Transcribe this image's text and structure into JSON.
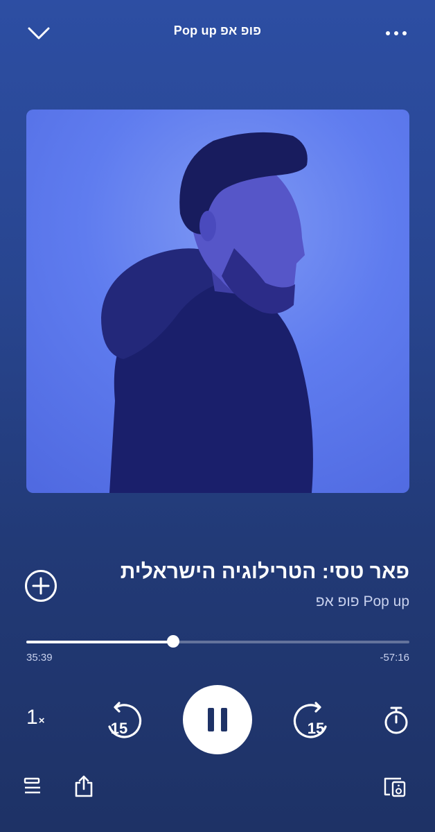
{
  "header": {
    "title": "Pop up פופ אפ",
    "icons": {
      "collapse": "chevron-down-icon",
      "more": "more-horizontal-icon"
    }
  },
  "episode": {
    "title": "פאר טסי: הטרילוגיה הישראלית",
    "show": "Pop up פופ אפ",
    "artwork": "man-in-hoodie-blue-portrait"
  },
  "playback": {
    "elapsed": "35:39",
    "remaining": "-57:16",
    "progress": 0.384,
    "speed_value": "1",
    "speed_suffix": "×",
    "skip_back_seconds": "15",
    "skip_forward_seconds": "15",
    "state": "playing"
  },
  "colors": {
    "background_top": "#2d4ea3",
    "background_bottom": "#1e3266",
    "artwork_tint": "#5f7cef",
    "text_secondary": "#c9d2ee"
  }
}
